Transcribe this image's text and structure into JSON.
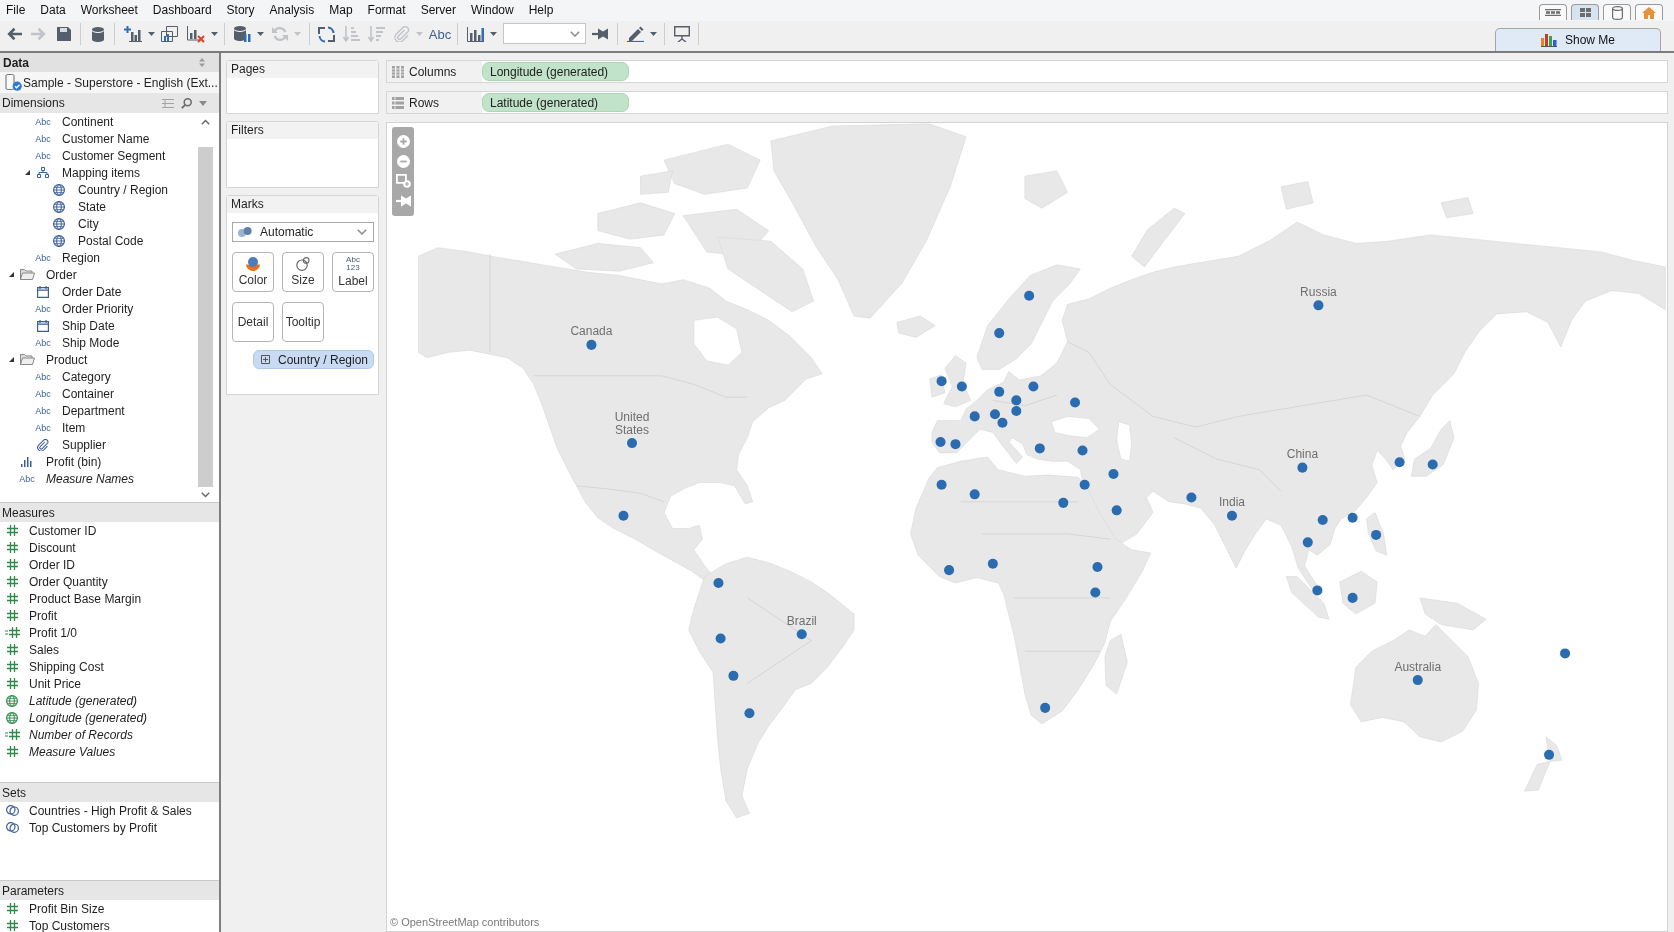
{
  "menu": [
    "File",
    "Data",
    "Worksheet",
    "Dashboard",
    "Story",
    "Analysis",
    "Map",
    "Format",
    "Server",
    "Window",
    "Help"
  ],
  "view_tabs": [
    {
      "kind": "filmstrip",
      "selected": false
    },
    {
      "kind": "sorter",
      "selected": true
    },
    {
      "kind": "data-source",
      "selected": false
    },
    {
      "kind": "start",
      "selected": false
    }
  ],
  "toolbar": [
    {
      "kind": "back",
      "disabled": false,
      "dropdown": false
    },
    {
      "kind": "forward",
      "disabled": true,
      "dropdown": false
    },
    {
      "kind": "save",
      "disabled": false,
      "dropdown": false
    },
    {
      "kind": "separator"
    },
    {
      "kind": "new-data-source",
      "disabled": false,
      "dropdown": false
    },
    {
      "kind": "separator"
    },
    {
      "kind": "new-worksheet",
      "disabled": false,
      "dropdown": true
    },
    {
      "kind": "duplicate",
      "disabled": false,
      "dropdown": false
    },
    {
      "kind": "clear",
      "disabled": false,
      "dropdown": true
    },
    {
      "kind": "separator"
    },
    {
      "kind": "pause-updates",
      "disabled": false,
      "dropdown": true
    },
    {
      "kind": "refresh",
      "disabled": true,
      "dropdown": true
    },
    {
      "kind": "separator"
    },
    {
      "kind": "swap",
      "disabled": false,
      "dropdown": false
    },
    {
      "kind": "sort-ascending",
      "disabled": true,
      "dropdown": false
    },
    {
      "kind": "sort-descending",
      "disabled": true,
      "dropdown": false
    },
    {
      "kind": "group",
      "disabled": true,
      "dropdown": true
    },
    {
      "kind": "labels",
      "label": "Abc",
      "disabled": false,
      "dropdown": false
    },
    {
      "kind": "separator"
    },
    {
      "kind": "chart-options",
      "disabled": false,
      "dropdown": true
    },
    {
      "kind": "fit-combo"
    },
    {
      "kind": "fix-axes",
      "disabled": false,
      "dropdown": false
    },
    {
      "kind": "separator"
    },
    {
      "kind": "highlight",
      "disabled": false,
      "dropdown": true
    },
    {
      "kind": "separator"
    },
    {
      "kind": "presentation",
      "disabled": false,
      "dropdown": false
    },
    {
      "kind": "separator"
    }
  ],
  "show_me": {
    "label": "Show Me"
  },
  "data_pane": {
    "title": "Data",
    "source": "Sample - Superstore - English (Ext...",
    "dimensions": {
      "title": "Dimensions",
      "items": [
        {
          "children": [
            {
              "label": "Continent",
              "kind": "string",
              "icon_text": "Abc",
              "generated": false
            },
            {
              "label": "Customer Name",
              "kind": "string",
              "icon_text": "Abc",
              "generated": false
            },
            {
              "label": "Customer Segment",
              "kind": "string",
              "icon_text": "Abc",
              "generated": false
            },
            {
              "label": "Mapping items",
              "kind": "hierarchy",
              "generated": false,
              "expanded": true,
              "children": [
                {
                  "label": "Country / Region",
                  "kind": "geo",
                  "generated": false
                },
                {
                  "label": "State",
                  "kind": "geo",
                  "generated": false
                },
                {
                  "label": "City",
                  "kind": "geo",
                  "generated": false
                },
                {
                  "label": "Postal Code",
                  "kind": "geo",
                  "generated": false
                }
              ]
            },
            {
              "label": "Region",
              "kind": "string",
              "icon_text": "Abc",
              "generated": false
            }
          ]
        },
        {
          "label": "Order",
          "kind": "folder",
          "generated": false,
          "expanded": true,
          "children": [
            {
              "label": "Order Date",
              "kind": "date",
              "generated": false
            },
            {
              "label": "Order Priority",
              "kind": "string",
              "icon_text": "Abc",
              "generated": false
            },
            {
              "label": "Ship Date",
              "kind": "date",
              "generated": false
            },
            {
              "label": "Ship Mode",
              "kind": "string",
              "icon_text": "Abc",
              "generated": false
            }
          ]
        },
        {
          "label": "Product",
          "kind": "folder",
          "generated": false,
          "expanded": true,
          "children": [
            {
              "label": "Category",
              "kind": "string",
              "icon_text": "Abc",
              "generated": false
            },
            {
              "label": "Container",
              "kind": "string",
              "icon_text": "Abc",
              "generated": false
            },
            {
              "label": "Department",
              "kind": "string",
              "icon_text": "Abc",
              "generated": false
            },
            {
              "label": "Item",
              "kind": "string",
              "icon_text": "Abc",
              "generated": false
            },
            {
              "label": "Supplier",
              "kind": "group",
              "generated": false
            }
          ]
        },
        {
          "label": "Profit (bin)",
          "kind": "bin",
          "generated": false
        },
        {
          "label": "Measure Names",
          "kind": "string",
          "icon_text": "Abc",
          "generated": true
        }
      ]
    },
    "measures": {
      "title": "Measures",
      "items": [
        {
          "label": "Customer ID",
          "kind": "number",
          "generated": false
        },
        {
          "label": "Discount",
          "kind": "number",
          "generated": false
        },
        {
          "label": "Order ID",
          "kind": "number",
          "generated": false
        },
        {
          "label": "Order Quantity",
          "kind": "number",
          "generated": false
        },
        {
          "label": "Product Base Margin",
          "kind": "number",
          "generated": false
        },
        {
          "label": "Profit",
          "kind": "number",
          "generated": false
        },
        {
          "label": "Profit 1/0",
          "kind": "calculated",
          "generated": false
        },
        {
          "label": "Sales",
          "kind": "number",
          "generated": false
        },
        {
          "label": "Shipping Cost",
          "kind": "number",
          "generated": false
        },
        {
          "label": "Unit Price",
          "kind": "number",
          "generated": false
        },
        {
          "label": "Latitude (generated)",
          "kind": "geo",
          "generated": true
        },
        {
          "label": "Longitude (generated)",
          "kind": "geo",
          "generated": true
        },
        {
          "label": "Number of Records",
          "kind": "calculated",
          "generated": true
        },
        {
          "label": "Measure Values",
          "kind": "number",
          "generated": true
        }
      ]
    },
    "sets": {
      "title": "Sets",
      "items": [
        {
          "label": "Countries - High Profit & Sales",
          "kind": "set"
        },
        {
          "label": "Top Customers by Profit",
          "kind": "set"
        }
      ]
    },
    "parameters": {
      "title": "Parameters",
      "items": [
        {
          "label": "Profit Bin Size",
          "kind": "number"
        },
        {
          "label": "Top Customers",
          "kind": "number"
        }
      ]
    }
  },
  "pages": {
    "title": "Pages"
  },
  "filters": {
    "title": "Filters"
  },
  "marks": {
    "title": "Marks",
    "mark_type": "Automatic",
    "cards": [
      {
        "kind": "color",
        "label": "Color"
      },
      {
        "kind": "size",
        "label": "Size"
      },
      {
        "kind": "label",
        "label": "Label",
        "icon_text": [
          "Abc",
          "123"
        ]
      },
      {
        "kind": "detail",
        "label": "Detail"
      },
      {
        "kind": "tooltip",
        "label": "Tooltip"
      }
    ],
    "fields": [
      {
        "label": "Country / Region",
        "expanded": false
      }
    ]
  },
  "shelves": [
    {
      "kind": "columns",
      "label": "Columns",
      "pills": [
        {
          "label": "Longitude (generated)"
        }
      ]
    },
    {
      "kind": "rows",
      "label": "Rows",
      "pills": [
        {
          "label": "Latitude (generated)"
        }
      ]
    }
  ],
  "map": {
    "labels": [
      "Russia",
      "Canada",
      "United States",
      "China",
      "India",
      "Brazil",
      "Australia"
    ],
    "attribution": "© OpenStreetMap contributors"
  }
}
